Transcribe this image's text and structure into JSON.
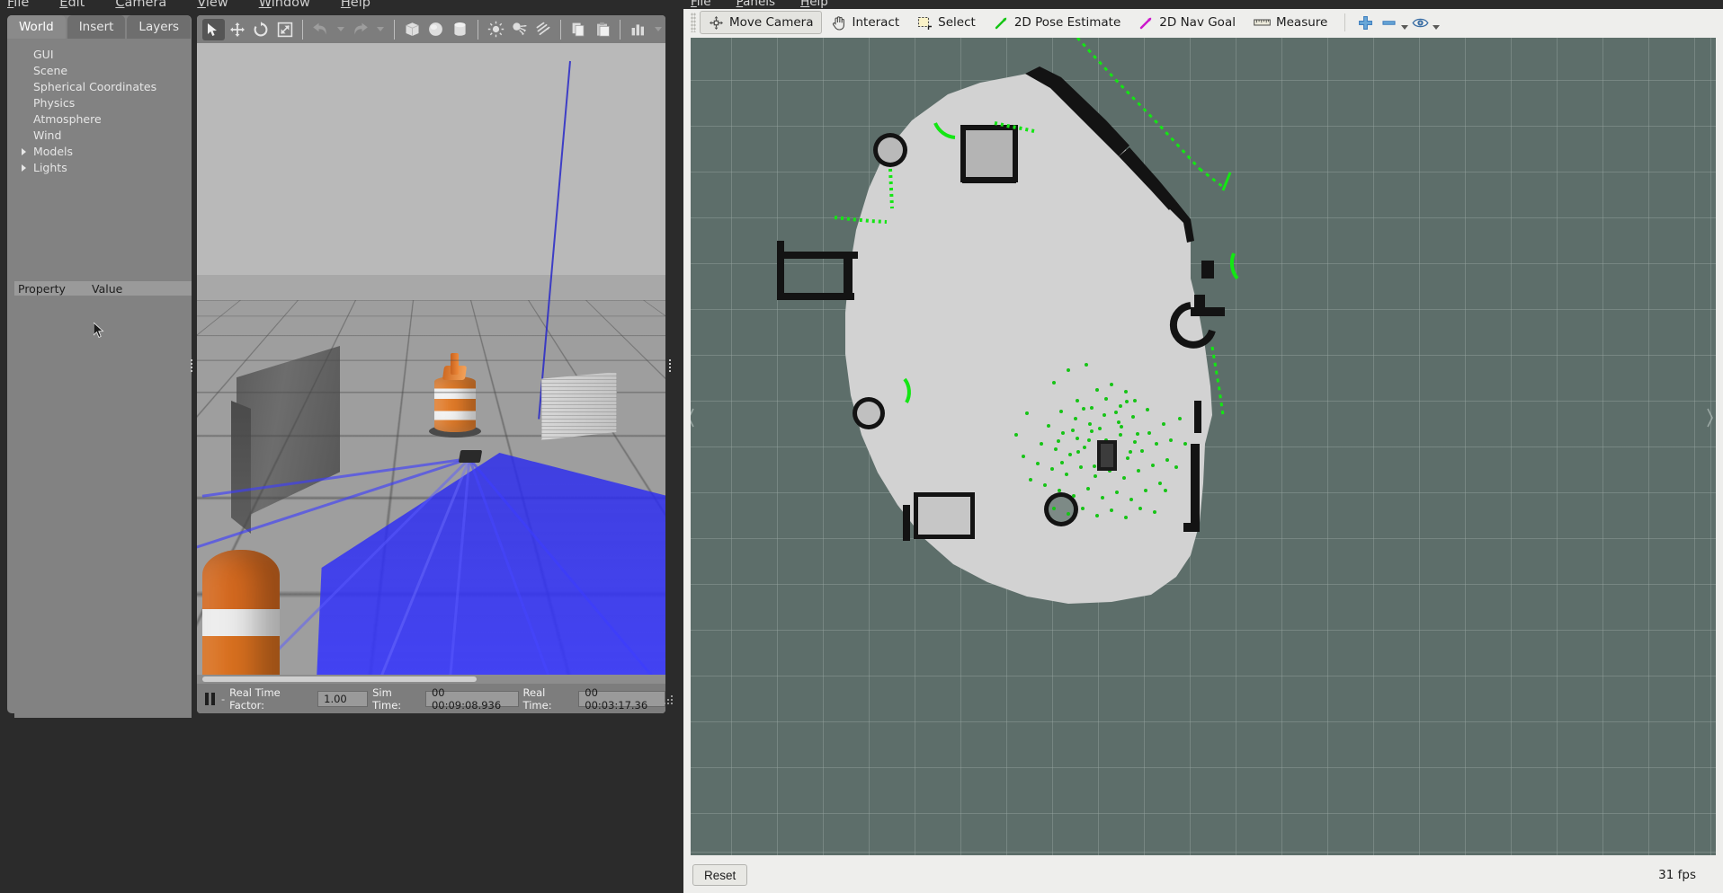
{
  "gazebo": {
    "menu": [
      {
        "label": "File",
        "mnemonic": "F"
      },
      {
        "label": "Edit",
        "mnemonic": "E"
      },
      {
        "label": "Camera",
        "mnemonic": "C"
      },
      {
        "label": "View",
        "mnemonic": "V"
      },
      {
        "label": "Window",
        "mnemonic": "W"
      },
      {
        "label": "Help",
        "mnemonic": "H"
      }
    ],
    "tabs": [
      {
        "label": "World",
        "active": true
      },
      {
        "label": "Insert",
        "active": false
      },
      {
        "label": "Layers",
        "active": false
      }
    ],
    "tree": [
      {
        "label": "GUI",
        "expandable": false
      },
      {
        "label": "Scene",
        "expandable": false
      },
      {
        "label": "Spherical Coordinates",
        "expandable": false
      },
      {
        "label": "Physics",
        "expandable": false
      },
      {
        "label": "Atmosphere",
        "expandable": false
      },
      {
        "label": "Wind",
        "expandable": false
      },
      {
        "label": "Models",
        "expandable": true
      },
      {
        "label": "Lights",
        "expandable": true
      }
    ],
    "property_table": {
      "columns": [
        "Property",
        "Value"
      ],
      "rows": []
    },
    "toolbar": [
      {
        "name": "select-mode",
        "active": true
      },
      {
        "name": "translate-mode",
        "active": false
      },
      {
        "name": "rotate-mode",
        "active": false
      },
      {
        "name": "scale-mode",
        "active": false
      },
      {
        "name": "undo",
        "active": false
      },
      {
        "name": "undo-history",
        "active": false
      },
      {
        "name": "redo",
        "active": false
      },
      {
        "name": "redo-history",
        "active": false
      },
      {
        "name": "insert-box",
        "active": false
      },
      {
        "name": "insert-sphere",
        "active": false
      },
      {
        "name": "insert-cylinder",
        "active": false
      },
      {
        "name": "point-light",
        "active": false
      },
      {
        "name": "spot-light",
        "active": false
      },
      {
        "name": "directional-light",
        "active": false
      },
      {
        "name": "copy",
        "active": false
      },
      {
        "name": "paste",
        "active": false
      },
      {
        "name": "align",
        "active": false
      },
      {
        "name": "snap-menu",
        "active": false
      }
    ],
    "status": {
      "pause_label": "Pause",
      "real_time_factor_label": "Real Time Factor:",
      "real_time_factor_value": "1.00",
      "sim_time_label": "Sim Time:",
      "sim_time_value": "00 00:09:08.936",
      "real_time_label": "Real Time:",
      "real_time_value": "00 00:03:17.36"
    }
  },
  "rviz": {
    "menu": [
      {
        "label": "File",
        "mnemonic": "F"
      },
      {
        "label": "Panels",
        "mnemonic": "P"
      },
      {
        "label": "Help",
        "mnemonic": "H"
      }
    ],
    "tools": [
      {
        "label": "Move Camera",
        "icon": "move-camera-icon",
        "active": true
      },
      {
        "label": "Interact",
        "icon": "interact-hand-icon",
        "active": false
      },
      {
        "label": "Select",
        "icon": "select-rect-icon",
        "active": false
      },
      {
        "label": "2D Pose Estimate",
        "icon": "pose-estimate-arrow-icon",
        "active": false
      },
      {
        "label": "2D Nav Goal",
        "icon": "nav-goal-arrow-icon",
        "active": false
      },
      {
        "label": "Measure",
        "icon": "ruler-icon",
        "active": false
      }
    ],
    "icon_buttons": [
      {
        "name": "add-tool-icon",
        "color": "#3f7fbf"
      },
      {
        "name": "remove-tool-icon",
        "color": "#3f7fbf"
      },
      {
        "name": "focus-camera-icon",
        "color": "#3a6ea5"
      }
    ],
    "colors": {
      "pose_estimate_arrow": "#14c414",
      "nav_goal_arrow": "#cc17cc",
      "view_background": "#5d6e6a",
      "map_occupied": "#111111",
      "map_free": "#d2d2d2",
      "laser_scan": "#14e614",
      "particle_cloud": "#14c414",
      "robot": "#2a2a2a"
    },
    "statusbar": {
      "reset_label": "Reset",
      "fps": "31 fps"
    }
  }
}
